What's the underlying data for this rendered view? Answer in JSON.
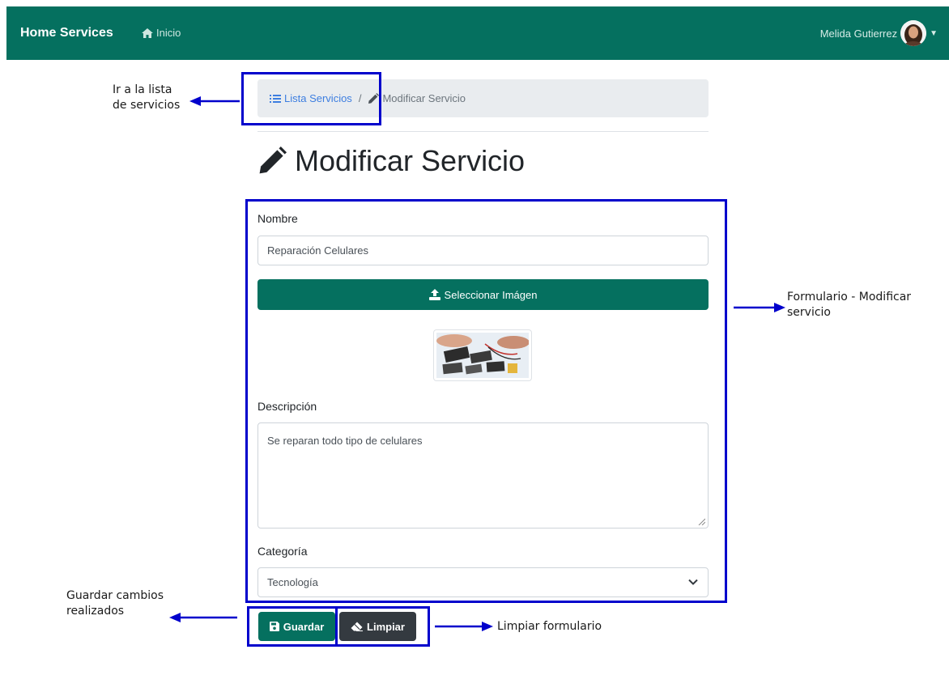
{
  "navbar": {
    "brand": "Home Services",
    "home_label": "Inicio",
    "user_name": "Melida Gutierrez"
  },
  "breadcrumb": {
    "list_label": "Lista Servicios",
    "separator": "/",
    "current_label": "Modificar Servicio"
  },
  "page": {
    "title": "Modificar Servicio"
  },
  "form": {
    "name_label": "Nombre",
    "name_value": "Reparación Celulares",
    "upload_label": "Seleccionar Imágen",
    "description_label": "Descripción",
    "description_value": "Se reparan todo tipo de celulares",
    "category_label": "Categoría",
    "category_value": "Tecnología"
  },
  "actions": {
    "save_label": "Guardar",
    "clear_label": "Limpiar"
  },
  "annotations": {
    "list_line1": "Ir a la lista",
    "list_line2": "de servicios",
    "form_line1": "Formulario - Modificar",
    "form_line2": "servicio",
    "save_line1": "Guardar cambios",
    "save_line2": "realizados",
    "clear": "Limpiar formulario"
  },
  "colors": {
    "primary": "#05705f",
    "dark_button": "#343a40",
    "annotation": "#0000cc"
  },
  "icons": {
    "home": "home-icon",
    "list": "list-icon",
    "pencil": "pencil-icon",
    "upload": "upload-icon",
    "save": "floppy-disk-icon",
    "eraser": "eraser-icon",
    "chevron": "chevron-down-icon",
    "arrow": "arrow-icon"
  }
}
